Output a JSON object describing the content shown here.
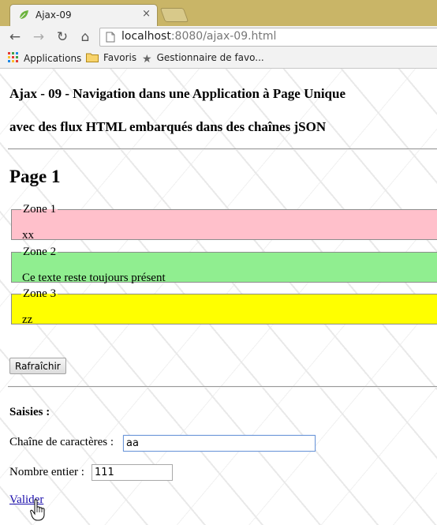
{
  "browser": {
    "tab_title": "Ajax-09",
    "tab_close": "×",
    "url_host": "localhost",
    "url_rest": ":8080/ajax-09.html",
    "bookmarks": [
      {
        "label": "Applications",
        "icon": "apps-grid-icon"
      },
      {
        "label": "Favoris",
        "icon": "folder-icon"
      },
      {
        "label": "Gestionnaire de favo...",
        "icon": "star-icon"
      }
    ]
  },
  "page": {
    "heading_line1": "Ajax - 09 - Navigation dans une Application à Page Unique",
    "heading_line2": "avec des flux HTML embarqués dans des chaînes jSON",
    "page_title": "Page 1",
    "zones": [
      {
        "legend": "Zone 1",
        "text": "xx",
        "color": "#ffc0cb"
      },
      {
        "legend": "Zone 2",
        "text": "Ce texte reste toujours présent",
        "color": "#90ee90"
      },
      {
        "legend": "Zone 3",
        "text": "zz",
        "color": "#ffff00"
      }
    ],
    "refresh_button": "Rafraîchir",
    "saisies_heading": "Saisies :",
    "string_label": "Chaîne de caractères :",
    "string_value": "aa",
    "int_label": "Nombre entier :",
    "int_value": "111",
    "submit_link": "Valider"
  }
}
